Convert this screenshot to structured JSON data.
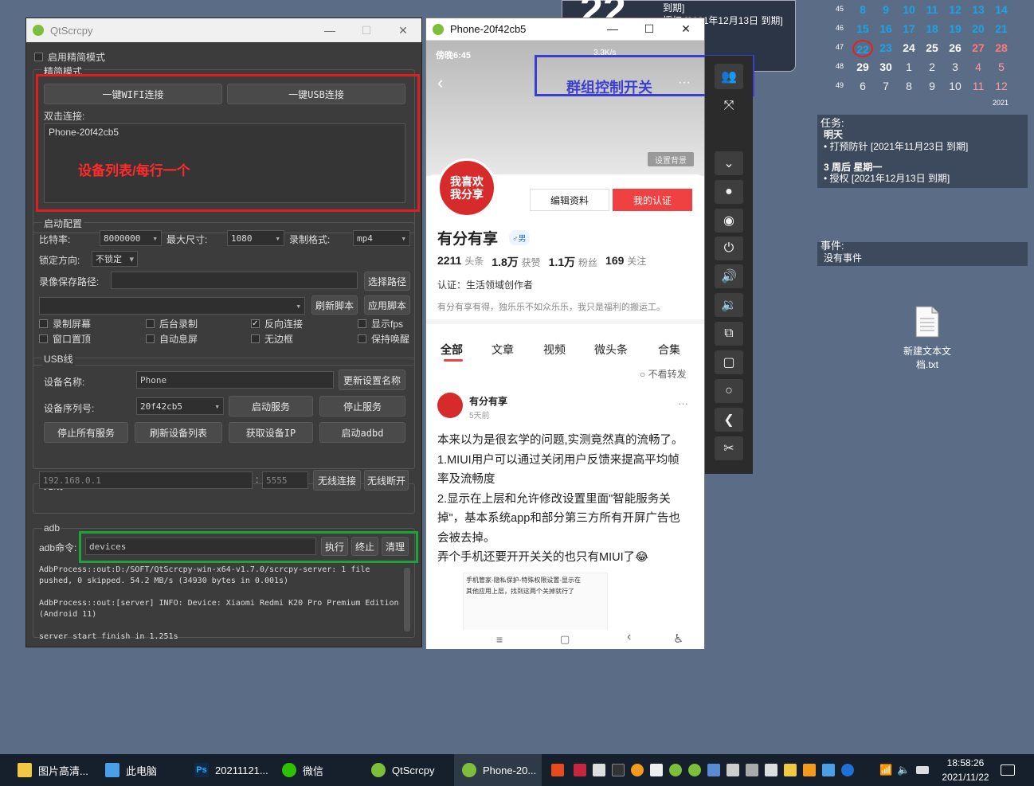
{
  "qtscrcpy": {
    "title": "QtScrcpy",
    "simple_mode_checkbox": "启用精简模式",
    "simple_mode_group": "精简模式",
    "wifi_connect": "一键WIFI连接",
    "usb_connect": "一键USB连接",
    "double_click_label": "双击连接:",
    "device_list_item": "Phone-20f42cb5",
    "device_list_annotation": "设备列表/每行一个",
    "start_config_group": "启动配置",
    "bitrate_label": "比特率:",
    "bitrate_value": "8000000",
    "max_size_label": "最大尺寸:",
    "max_size_value": "1080",
    "record_format_label": "录制格式:",
    "record_format_value": "mp4",
    "lock_orientation_label": "锁定方向:",
    "lock_orientation_value": "不锁定",
    "record_path_label": "录像保存路径:",
    "choose_path": "选择路径",
    "refresh_script": "刷新脚本",
    "apply_script": "应用脚本",
    "checkboxes": {
      "record_screen": "录制屏幕",
      "background_record": "后台录制",
      "reverse_connect": "反向连接",
      "show_fps": "显示fps",
      "window_top": "窗口置顶",
      "auto_screen_off": "自动息屏",
      "frameless": "无边框",
      "stay_awake": "保持唤醒"
    },
    "usb_group": "USB线",
    "device_name_label": "设备名称:",
    "device_name_value": "Phone",
    "update_name": "更新设置名称",
    "device_serial_label": "设备序列号:",
    "device_serial_value": "20f42cb5",
    "start_service": "启动服务",
    "stop_service": "停止服务",
    "stop_all_service": "停止所有服务",
    "refresh_devices": "刷新设备列表",
    "get_device_ip": "获取设备IP",
    "start_adbd": "启动adbd",
    "wireless_group": "无线",
    "ip_placeholder": "192.168.0.1",
    "port_placeholder": "5555",
    "wireless_connect": "无线连接",
    "wireless_disconnect": "无线断开",
    "adb_group": "adb",
    "adb_command_label": "adb命令:",
    "adb_command_value": "devices",
    "execute": "执行",
    "terminate": "终止",
    "clear": "清理",
    "log": "AdbProcess::out:D:/SOFT/QtScrcpy-win-x64-v1.7.0/scrcpy-server: 1 file\npushed, 0 skipped. 54.2 MB/s (34930 bytes in 0.001s)\n\nAdbProcess::out:[server] INFO: Device: Xiaomi Redmi K20 Pro Premium Edition\n(Android 11)\n\nserver start finish in 1.251s"
  },
  "phone": {
    "title": "Phone-20f42cb5",
    "status_time": "傍晚6:45",
    "status_speed": "3.3K/s",
    "group_control_annotation": "群组控制开关",
    "set_background": "设置背景",
    "edit_profile": "编辑资料",
    "my_cert": "我的认证",
    "avatar_text": "我喜欢我分享",
    "profile_name": "有分有享",
    "gender": "♂男",
    "stats": [
      {
        "num": "2211",
        "label": "头条"
      },
      {
        "num": "1.8万",
        "label": "获赞"
      },
      {
        "num": "1.1万",
        "label": "粉丝"
      },
      {
        "num": "169",
        "label": "关注"
      }
    ],
    "certification": "认证：生活领域创作者",
    "bio": "有分有享有得，独乐乐不如众乐乐，我只是福利的搬运工。",
    "tabs": [
      "全部",
      "文章",
      "视频",
      "微头条",
      "合集"
    ],
    "no_repost": "不看转发",
    "post_author": "有分有享",
    "post_time": "5天前",
    "post_lines": [
      "本来以为是很玄学的问题,实测竟然真的流畅了。",
      "1.MIUI用户可以通过关闭用户反馈来提高平均帧",
      "率及流畅度",
      "2.显示在上层和允许修改设置里面\"智能服务关",
      "掉\"，基本系统app和部分第三方所有开屏广告也",
      "会被去掉。",
      "弄个手机还要开开关关的也只有MIUI了😂"
    ],
    "image_caption_1": "手机管家-隐私保护-特殊权限设置-显示在",
    "image_caption_2": "其他应用上层，找到这两个关掉就行了"
  },
  "calendar": {
    "big_number": "22",
    "top_text_1": "到期]",
    "top_text_2": "授权 [2021年12月13日 到期]",
    "weeks": [
      {
        "wk": "45",
        "days": [
          "8",
          "9",
          "10",
          "11",
          "12",
          "13",
          "14"
        ]
      },
      {
        "wk": "46",
        "days": [
          "15",
          "16",
          "17",
          "18",
          "19",
          "20",
          "21"
        ]
      },
      {
        "wk": "47",
        "days": [
          "22",
          "23",
          "24",
          "25",
          "26",
          "27",
          "28"
        ]
      },
      {
        "wk": "48",
        "days": [
          "29",
          "30",
          "1",
          "2",
          "3",
          "4",
          "5"
        ]
      },
      {
        "wk": "49",
        "days": [
          "6",
          "7",
          "8",
          "9",
          "10",
          "11",
          "12"
        ]
      }
    ],
    "year": "2021",
    "accent_color": "#1aa3e8",
    "weekend_color": "#ff7a7a"
  },
  "tasks": {
    "title": "任务:",
    "tomorrow": "明天",
    "task1": "• 打预防针 [2021年11月23日 到期]",
    "later": "3 周后 星期一",
    "task2": "• 授权 [2021年12月13日 到期]"
  },
  "events": {
    "title": "事件:",
    "none": "没有事件"
  },
  "desktop_file": {
    "line1": "新建文本文",
    "line2": "档.txt"
  },
  "taskbar": {
    "items": [
      "图片高清...",
      "此电脑",
      "20211121...",
      "微信",
      "QtScrcpy",
      "Phone-20..."
    ],
    "time": "18:58:26",
    "date": "2021/11/22"
  }
}
